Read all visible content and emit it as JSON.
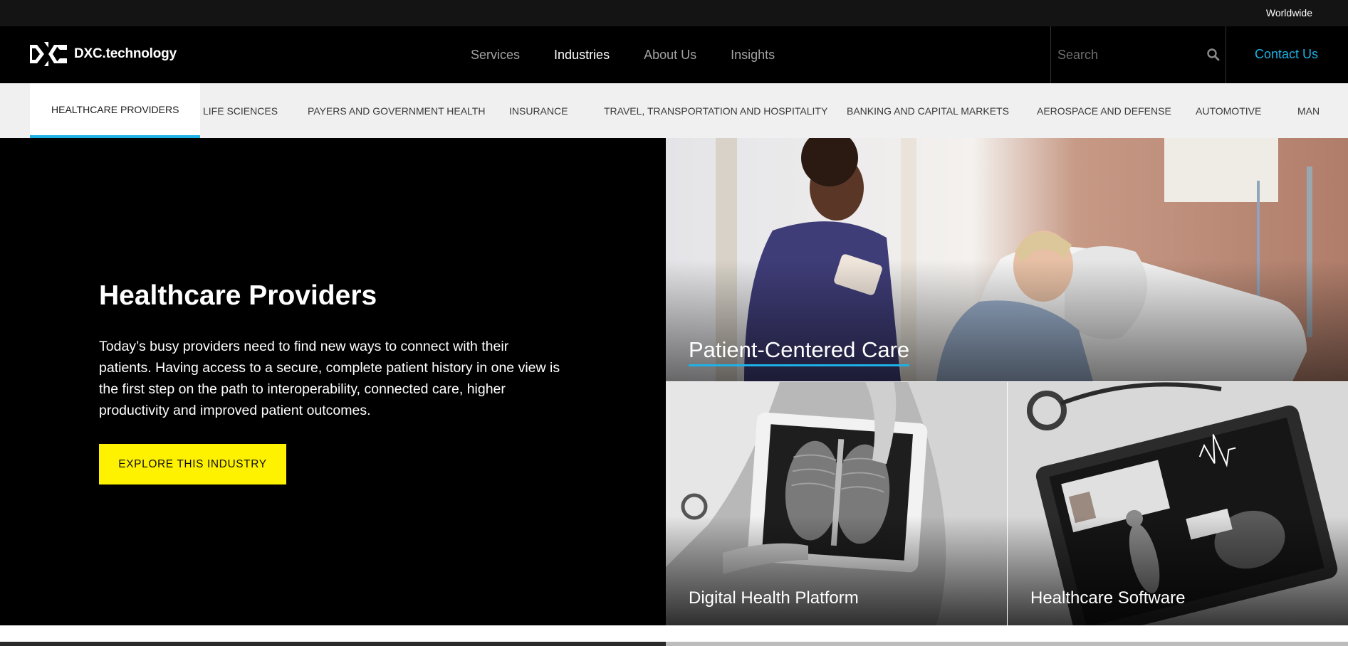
{
  "utility": {
    "region_label": "Worldwide"
  },
  "header": {
    "logo_text": "DXC.technology",
    "nav": [
      "Services",
      "Industries",
      "About Us",
      "Insights"
    ],
    "active_nav": "Industries",
    "search_placeholder": "Search",
    "contact_label": "Contact Us"
  },
  "tabs": [
    "HEALTHCARE PROVIDERS",
    "LIFE SCIENCES",
    "PAYERS AND GOVERNMENT HEALTH",
    "INSURANCE",
    "TRAVEL, TRANSPORTATION AND HOSPITALITY",
    "BANKING AND CAPITAL MARKETS",
    "AEROSPACE AND DEFENSE",
    "AUTOMOTIVE",
    "MAN"
  ],
  "active_tab": "HEALTHCARE PROVIDERS",
  "hero": {
    "title": "Healthcare Providers",
    "body": "Today’s busy providers need to find new ways to connect with their patients. Having access to a secure, complete patient history in one view is the first step on the path to interoperability, connected care, higher productivity and improved patient outcomes.",
    "cta_label": "EXPLORE THIS INDUSTRY"
  },
  "tiles": [
    {
      "label": "Patient-Centered Care"
    },
    {
      "label": "Digital Health Platform"
    },
    {
      "label": "Healthcare Software"
    }
  ],
  "colors": {
    "accent": "#1fb1e6",
    "cta": "#fff200",
    "header_bg": "#000000",
    "utility_bg": "#141414",
    "tabs_bg": "#f0f0f0"
  }
}
